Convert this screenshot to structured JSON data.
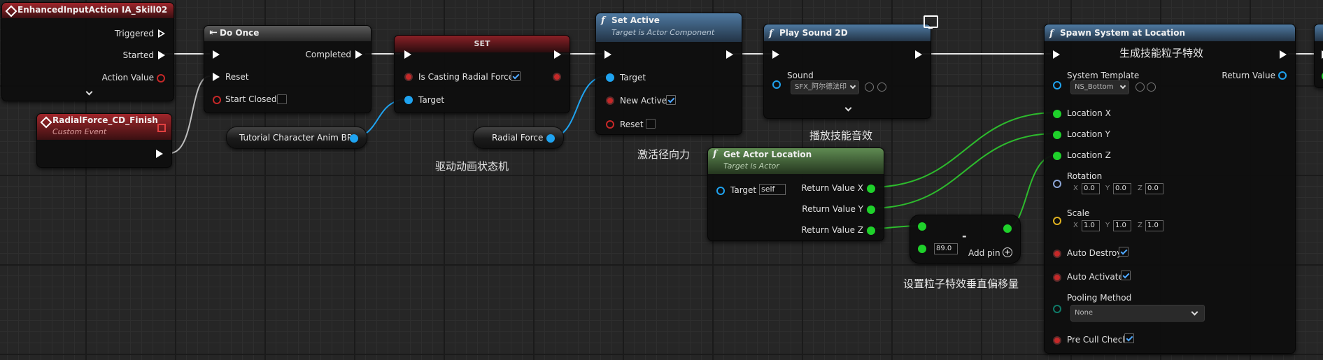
{
  "nodes": {
    "input_action": {
      "title": "EnhancedInputAction IA_Skill02",
      "pins": {
        "triggered": "Triggered",
        "started": "Started",
        "action_value": "Action Value"
      }
    },
    "custom_event": {
      "title": "RadialForce_CD_Finish",
      "subtitle": "Custom Event"
    },
    "do_once": {
      "title": "Do Once",
      "pins": {
        "completed": "Completed",
        "reset": "Reset",
        "start_closed": "Start Closed"
      }
    },
    "set": {
      "title": "SET",
      "pins": {
        "is_casting": "Is Casting Radial Force",
        "target": "Target"
      }
    },
    "set_active": {
      "title": "Set Active",
      "subtitle": "Target is Actor Component",
      "pins": {
        "target": "Target",
        "new_active": "New Active",
        "reset": "Reset"
      }
    },
    "play_sound": {
      "title": "Play Sound 2D",
      "pins": {
        "sound": "Sound",
        "sound_value": "SFX_阿尔德法印"
      }
    },
    "get_actor_location": {
      "title": "Get Actor Location",
      "subtitle": "Target is Actor",
      "pins": {
        "target": "Target",
        "target_value": "self",
        "rx": "Return Value X",
        "ry": "Return Value Y",
        "rz": "Return Value Z"
      }
    },
    "subtract": {
      "symbol": "-",
      "value": "89.0",
      "add_pin": "Add pin"
    },
    "spawn_system": {
      "title": "Spawn System at Location",
      "pins": {
        "system_template": "System Template",
        "template_value": "NS_Bottom",
        "return_value": "Return Value",
        "loc_x": "Location X",
        "loc_y": "Location Y",
        "loc_z": "Location Z",
        "rotation": "Rotation",
        "rot_x": "0.0",
        "rot_y": "0.0",
        "rot_z": "0.0",
        "scale": "Scale",
        "scale_x": "1.0",
        "scale_y": "1.0",
        "scale_z": "1.0",
        "auto_destroy": "Auto Destroy",
        "auto_activate": "Auto Activate",
        "pooling_method": "Pooling Method",
        "pooling_value": "None",
        "pre_cull_check": "Pre Cull Check"
      },
      "axis": {
        "x": "X",
        "y": "Y",
        "z": "Z"
      }
    }
  },
  "variables": {
    "anim_bp": "Tutorial Character Anim BP",
    "radial_force": "Radial Force"
  },
  "comments": {
    "drive_anim": "驱动动画状态机",
    "activate_force": "激活径向力",
    "play_sound": "播放技能音效",
    "spawn_effect": "生成技能粒子特效",
    "offset": "设置粒子特效垂直偏移量"
  },
  "checkboxes": {
    "is_casting": true,
    "new_active": true,
    "reset": false,
    "start_closed": false,
    "auto_destroy": true,
    "auto_activate": true,
    "pre_cull_check": true
  },
  "colors": {
    "exec": "#ffffff",
    "object": "#1fa3f0",
    "float": "#1fd12b",
    "event_header": "#a0262b",
    "function_header": "#4f7aa2",
    "pure_header": "#5f8b52"
  }
}
